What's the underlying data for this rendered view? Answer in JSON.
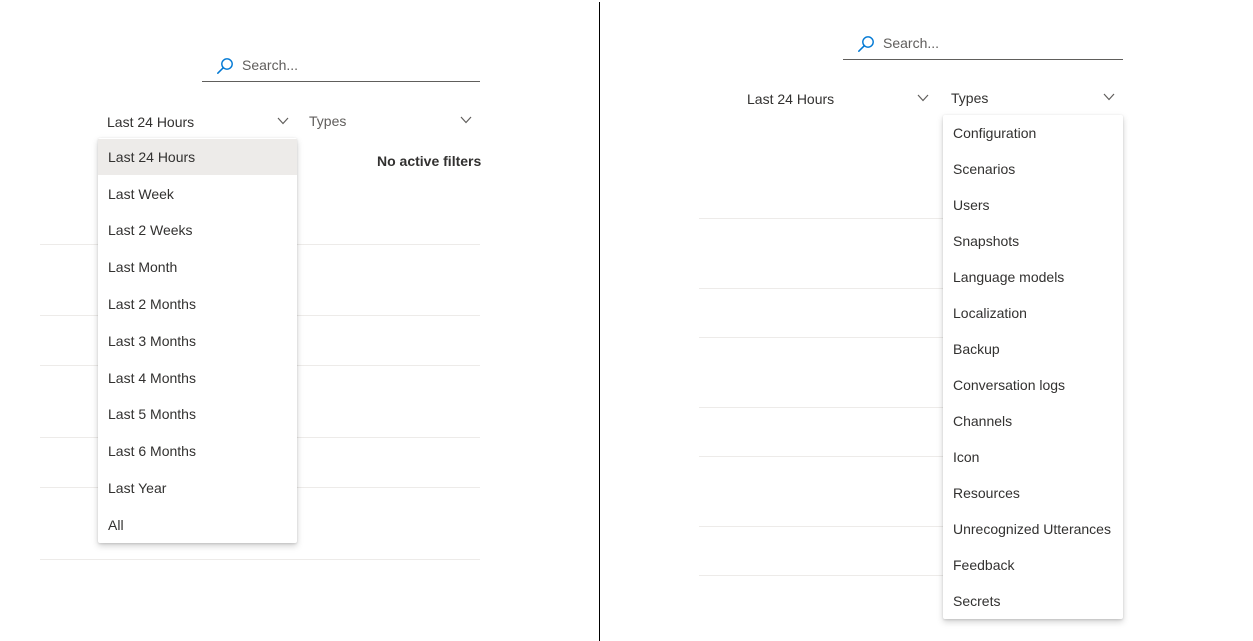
{
  "left": {
    "search_placeholder": "Search...",
    "time_dropdown": "Last 24 Hours",
    "types_dropdown": "Types",
    "no_filters_text": "No active filters",
    "time_options": [
      "Last 24 Hours",
      "Last Week",
      "Last 2 Weeks",
      "Last Month",
      "Last 2 Months",
      "Last 3 Months",
      "Last 4 Months",
      "Last 5 Months",
      "Last 6 Months",
      "Last Year",
      "All"
    ],
    "selected_option": "Last 24 Hours"
  },
  "right": {
    "search_placeholder": "Search...",
    "time_dropdown": "Last 24 Hours",
    "types_dropdown": "Types",
    "type_options": [
      "Configuration",
      "Scenarios",
      "Users",
      "Snapshots",
      "Language models",
      "Localization",
      "Backup",
      "Conversation logs",
      "Channels",
      "Icon",
      "Resources",
      "Unrecognized Utterances",
      "Feedback",
      "Secrets"
    ]
  },
  "icons": {
    "search": "search-icon",
    "chevron": "chevron-down-icon"
  },
  "colors": {
    "accent": "#0078d4",
    "menu_selected_bg": "#edebe9",
    "text": "#323130",
    "divider": "#000000"
  }
}
